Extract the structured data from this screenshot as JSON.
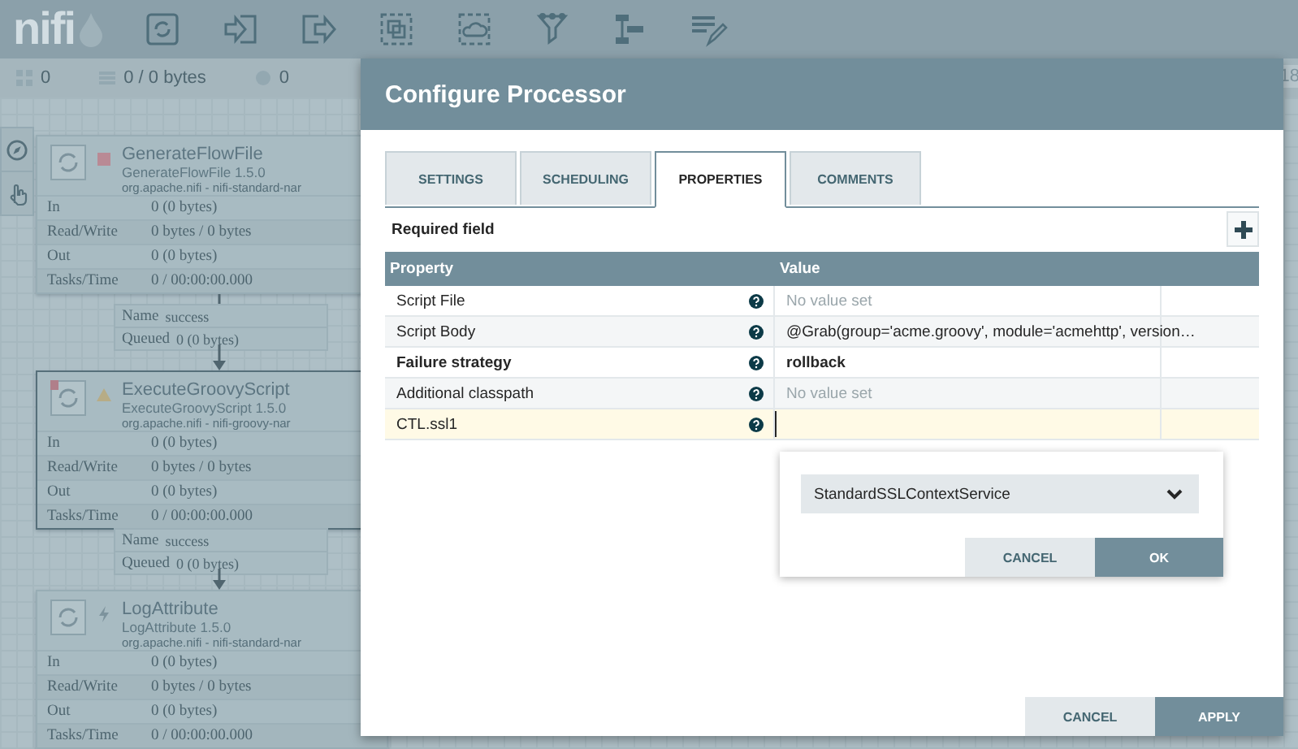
{
  "toolbar": {
    "logo": "nifi"
  },
  "status_bar": {
    "items": [
      {
        "kind": "components",
        "text": "0"
      },
      {
        "kind": "queued",
        "text": "0 / 0 bytes"
      },
      {
        "kind": "transmitting",
        "text": "0"
      }
    ],
    "right_text": "18"
  },
  "canvas": {
    "processors": [
      {
        "name": "GenerateFlowFile",
        "type": "GenerateFlowFile 1.5.0",
        "bundle": "org.apache.nifi - nifi-standard-nar",
        "kind": "stopped",
        "restricted": false,
        "selected": false,
        "stats": [
          {
            "label": "In",
            "value": "0 (0 bytes)"
          },
          {
            "label": "Read/Write",
            "value": "0 bytes / 0 bytes"
          },
          {
            "label": "Out",
            "value": "0 (0 bytes)"
          },
          {
            "label": "Tasks/Time",
            "value": "0 / 00:00:00.000"
          }
        ]
      },
      {
        "name": "ExecuteGroovyScript",
        "type": "ExecuteGroovyScript 1.5.0",
        "bundle": "org.apache.nifi - nifi-groovy-nar",
        "kind": "invalid",
        "restricted": true,
        "selected": true,
        "stats": [
          {
            "label": "In",
            "value": "0 (0 bytes)"
          },
          {
            "label": "Read/Write",
            "value": "0 bytes / 0 bytes"
          },
          {
            "label": "Out",
            "value": "0 (0 bytes)"
          },
          {
            "label": "Tasks/Time",
            "value": "0 / 00:00:00.000"
          }
        ]
      },
      {
        "name": "LogAttribute",
        "type": "LogAttribute 1.5.0",
        "bundle": "org.apache.nifi - nifi-standard-nar",
        "kind": "disabled",
        "restricted": false,
        "selected": false,
        "stats": [
          {
            "label": "In",
            "value": "0 (0 bytes)"
          },
          {
            "label": "Read/Write",
            "value": "0 bytes / 0 bytes"
          },
          {
            "label": "Out",
            "value": "0 (0 bytes)"
          },
          {
            "label": "Tasks/Time",
            "value": "0 / 00:00:00.000"
          }
        ]
      }
    ],
    "connections": [
      {
        "name_label": "Name",
        "name": "success",
        "queued_label": "Queued",
        "queued": "0 (0 bytes)"
      },
      {
        "name_label": "Name",
        "name": "success",
        "queued_label": "Queued",
        "queued": "0 (0 bytes)"
      }
    ]
  },
  "dialog": {
    "title": "Configure Processor",
    "tabs": [
      {
        "label": "SETTINGS",
        "selected": false
      },
      {
        "label": "SCHEDULING",
        "selected": false
      },
      {
        "label": "PROPERTIES",
        "selected": true
      },
      {
        "label": "COMMENTS",
        "selected": false
      }
    ],
    "required_field": "Required field",
    "table": {
      "columns": [
        "Property",
        "Value"
      ],
      "rows": [
        {
          "property": "Script File",
          "placeholder": "No value set",
          "required": false,
          "selected": false
        },
        {
          "property": "Script Body",
          "value": "@Grab(group='acme.groovy', module='acmehttp', version…",
          "required": false,
          "selected": false
        },
        {
          "property": "Failure strategy",
          "value": "rollback",
          "required": true,
          "selected": false
        },
        {
          "property": "Additional classpath",
          "placeholder": "No value set",
          "required": false,
          "selected": false
        },
        {
          "property": "CTL.ssl1",
          "required": false,
          "selected": true
        }
      ]
    },
    "editor": {
      "value": "StandardSSLContextService",
      "buttons": [
        "CANCEL",
        "OK"
      ]
    },
    "buttons": [
      "CANCEL",
      "APPLY"
    ]
  }
}
